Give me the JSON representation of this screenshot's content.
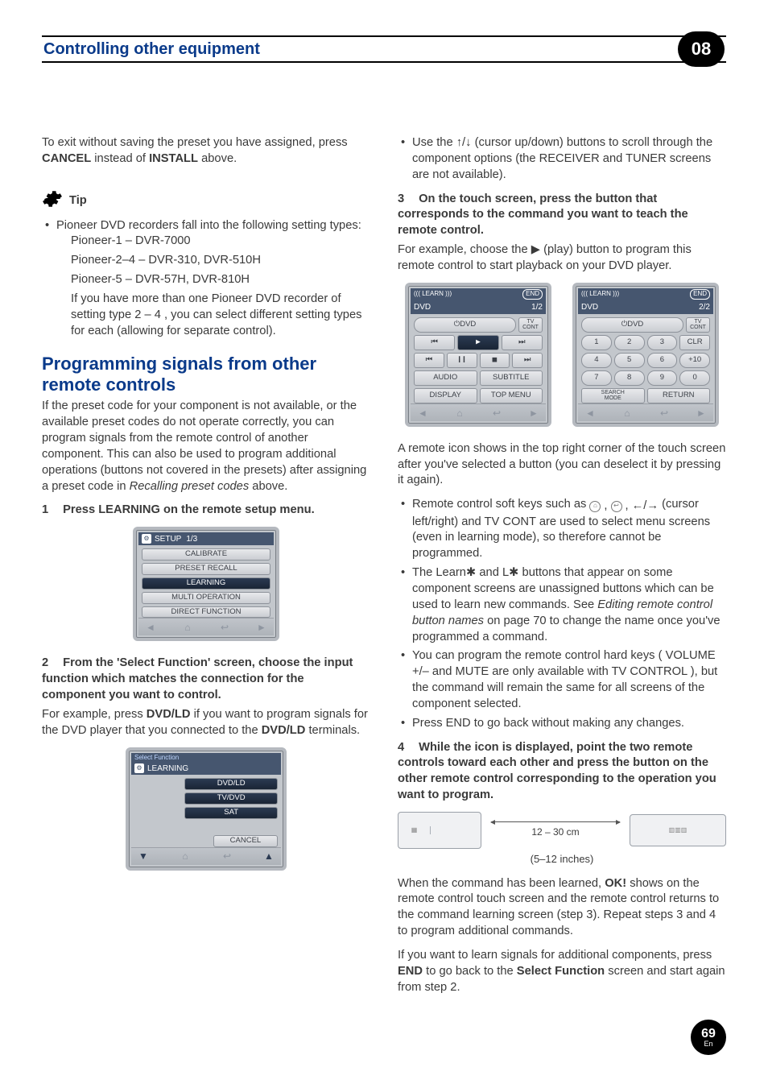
{
  "header": {
    "title": "Controlling other equipment",
    "chapter": "08"
  },
  "intro": {
    "p1a": "To exit without saving the preset you have assigned, press ",
    "cancel": "CANCEL",
    "p1b": " instead of ",
    "install": "INSTALL",
    "p1c": " above."
  },
  "tip": {
    "label": "Tip",
    "line1": "Pioneer DVD recorders fall into the following setting types:",
    "p1a": "Pioneer-1",
    "p1b": " – DVR-7000",
    "p2a": "Pioneer-2",
    "p2b": "–",
    "p2c": "4",
    "p2d": " – DVR-310, DVR-510H",
    "p3a": "Pioneer-5",
    "p3b": " – DVR-57H, DVR-810H",
    "note": "If you have more than one Pioneer DVD recorder of setting type ",
    "noteB1": "2",
    "noteDash": "–",
    "noteB2": "4",
    "note2": ", you can select different setting types for each (allowing for separate control)."
  },
  "h2": "Programming signals from other remote controls",
  "left": {
    "para": "If the preset code for your component is not available, or the available preset codes do not operate correctly, you can program signals from the remote control of another component. This can also be used to program additional operations (buttons not covered in the presets) after assigning a preset code in ",
    "paraItalic": "Recalling preset codes",
    "paraTail": " above.",
    "step1": {
      "num": "1",
      "text": "Press LEARNING on the remote setup menu."
    },
    "setup": {
      "title": "SETUP",
      "page": "1/3",
      "items": [
        "CALIBRATE",
        "PRESET RECALL",
        "LEARNING",
        "MULTI OPERATION",
        "DIRECT FUNCTION"
      ]
    },
    "step2": {
      "num": "2",
      "text": "From the 'Select Function' screen, choose the input function which matches the connection for the component you want to control."
    },
    "step2p": "For example, press ",
    "step2b": "DVD/LD",
    "step2t": " if you want to program signals for the DVD player that you connected to the ",
    "step2b2": "DVD/LD",
    "step2t2": " terminals.",
    "learning": {
      "banner": "Select Function",
      "title": "LEARNING",
      "items": [
        "DVD/LD",
        "TV/DVD",
        "SAT"
      ],
      "cancel": "CANCEL"
    }
  },
  "right": {
    "b1a": "Use the ",
    "b1arrows": "↑/↓",
    "b1b": " (cursor up/down) buttons to scroll through the component options (the ",
    "b1bold1": "RECEIVER",
    "b1c": " and ",
    "b1bold2": "TUNER",
    "b1d": " screens are not available).",
    "step3": {
      "num": "3",
      "text": "On the touch screen, press the button that corresponds to the command you want to teach the remote control."
    },
    "step3p": "For example, choose the ▶ (play) button to program this remote control to start playback on your DVD player.",
    "dvd1": {
      "learn": "LEARN",
      "end": "END",
      "title": "DVD",
      "page": "1/2",
      "dvdBtn": "DVD",
      "tvcont": "TV\nCONT",
      "r2": [
        "⏮",
        "▶",
        "⏭"
      ],
      "r3": [
        "⏮",
        "❙❙",
        "■",
        "⏭"
      ],
      "r4": [
        "AUDIO",
        "SUBTITLE"
      ],
      "r5": [
        "DISPLAY",
        "TOP MENU"
      ]
    },
    "dvd2": {
      "learn": "LEARN",
      "end": "END",
      "title": "DVD",
      "page": "2/2",
      "dvdBtn": "DVD",
      "tvcont": "TV\nCONT",
      "r2": [
        "1",
        "2",
        "3",
        "CLR"
      ],
      "r3": [
        "4",
        "5",
        "6",
        "+10"
      ],
      "r4": [
        "7",
        "8",
        "9",
        "0"
      ],
      "r5": [
        "SEARCH\nMODE",
        "RETURN"
      ]
    },
    "afterDvd": "A remote icon shows in the top right corner of the touch screen after you've selected a button (you can deselect it by pressing it again).",
    "bul1a": "Remote control soft keys such as ",
    "bul1b": " (cursor left/right) and ",
    "bul1bold": "TV CONT",
    "bul1c": " are used to select menu screens (even in learning mode), so therefore cannot be programmed.",
    "bul2a": "The ",
    "bul2b1": "Learn✱",
    "bul2b": " and ",
    "bul2b2": "L✱",
    "bul2c": " buttons that appear on some component screens are unassigned buttons which can be used to learn new commands. See ",
    "bul2it": "Editing remote control button names",
    "bul2d": " on page 70 to change the name once you've programmed a command.",
    "bul3a": "You can program the remote control hard keys (",
    "bul3b1": "VOLUME +/–",
    "bul3b": " and ",
    "bul3b2": "MUTE",
    "bul3c": " are only available with ",
    "bul3b3": "TV CONTROL",
    "bul3d": "), but the command will remain the same for all screens of the component selected.",
    "bul4a": "Press ",
    "bul4b": "END",
    "bul4c": " to go back without making any changes.",
    "step4": {
      "num": "4",
      "text": " While the icon is displayed, point the two remote controls toward each other and press the button on the other remote control corresponding to the operation you want to program."
    },
    "dist": "12 – 30 cm",
    "dist2": "(5–12 inches)",
    "okp1": "When the command has been learned, ",
    "okb": "OK!",
    "okp2": " shows on the remote control touch screen and the remote control returns to the command learning screen (step 3). Repeat steps 3 and 4 to program additional commands.",
    "last1": "If you want to learn signals for additional components, press ",
    "lastb1": "END",
    "last2": " to go back to the ",
    "lastb2": "Select Function",
    "last3": " screen and start again from step 2."
  },
  "footer": {
    "page": "69",
    "lang": "En"
  }
}
